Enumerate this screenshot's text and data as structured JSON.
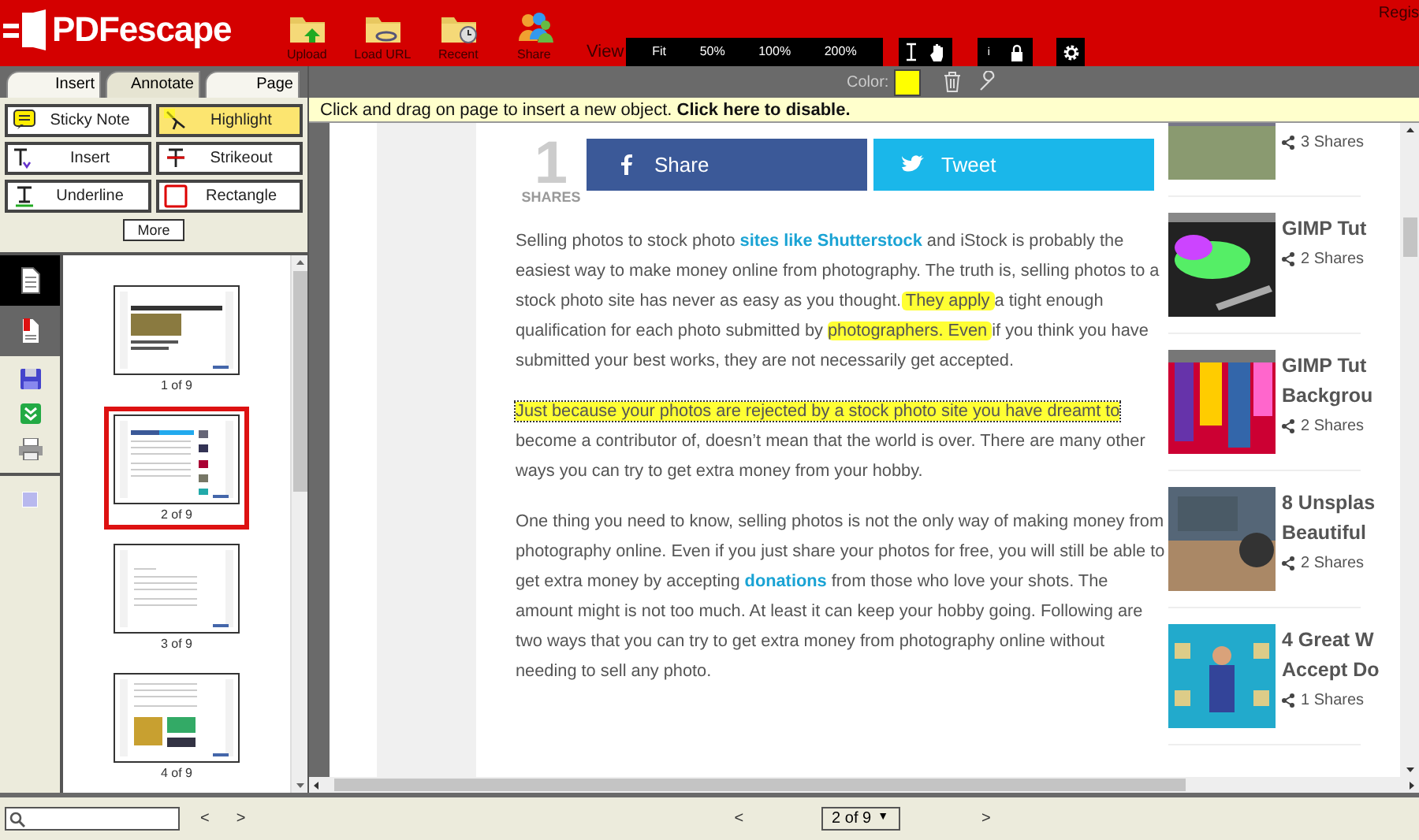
{
  "header": {
    "logo": "PDFescape",
    "register": "Regis",
    "tools": [
      {
        "label": "Upload"
      },
      {
        "label": "Load URL"
      },
      {
        "label": "Recent"
      },
      {
        "label": "Share"
      }
    ],
    "view_label": "View",
    "zoom_options": [
      "Fit",
      "50%",
      "100%",
      "200%"
    ],
    "info_glyph": "i"
  },
  "tabs": [
    {
      "label": "Insert",
      "selected": false
    },
    {
      "label": "Annotate",
      "selected": true
    },
    {
      "label": "Page",
      "selected": false
    }
  ],
  "tools": [
    {
      "label": "Sticky Note",
      "kind": "note",
      "selected": false
    },
    {
      "label": "Highlight",
      "kind": "highlight",
      "selected": true
    },
    {
      "label": "Insert",
      "kind": "insert",
      "selected": false
    },
    {
      "label": "Strikeout",
      "kind": "strike",
      "selected": false
    },
    {
      "label": "Underline",
      "kind": "underline",
      "selected": false
    },
    {
      "label": "Rectangle",
      "kind": "rect",
      "selected": false
    }
  ],
  "more_button": "More",
  "annotation_bar": {
    "color_label": "Color:",
    "color": "#ffff00"
  },
  "hint": "Click and drag on page to insert a new object. **Click here to disable.**",
  "panel_tabs": [
    {
      "selected": true
    },
    {
      "selected": false
    }
  ],
  "thumbnails": [
    {
      "label": "1 of 9",
      "selected": false
    },
    {
      "label": "2 of 9",
      "selected": true
    },
    {
      "label": "3 of 9",
      "selected": false
    },
    {
      "label": "4 of 9",
      "selected": false
    }
  ],
  "document": {
    "share_count": "1",
    "share_caption": "SHARES",
    "share_buttons": [
      {
        "label": "Share",
        "kind": "facebook"
      },
      {
        "label": "Tweet",
        "kind": "twitter"
      }
    ],
    "paragraphs": [
      [
        {
          "text": "Selling photos to stock photo ",
          "kind": "text"
        },
        {
          "text": "sites like Shutterstock",
          "kind": "link"
        },
        {
          "text": " and iStock is probably the easiest way to make money online from photography. The truth is, selling photos to a stock photo site has never as easy as you thought.",
          "kind": "text"
        },
        {
          "text": " They apply ",
          "kind": "highlight",
          "selected": false
        },
        {
          "text": "a tight enough qualification for each photo submitted by ",
          "kind": "text"
        },
        {
          "text": " photographers. Even ",
          "kind": "highlight",
          "selected": false
        },
        {
          "text": "if you think you have submitted your best works, they are not necessarily get accepted.",
          "kind": "text"
        }
      ],
      [
        {
          "text": "Just because your photos are rejected by a stock photo site you have dreamt to",
          "kind": "highlight",
          "selected": true
        },
        {
          "text": " become a contributor of, doesn’t mean that the world is over. There are many other ways you can try to get extra money from your hobby.",
          "kind": "text"
        }
      ],
      [
        {
          "text": "One thing you need to know, selling photos is not the only way of making money from photography online. Even if you just share your photos for free, you will still be able to get extra money by accepting ",
          "kind": "text"
        },
        {
          "text": "donations",
          "kind": "link"
        },
        {
          "text": " from those who love your shots. The amount might is not too much. At least it can keep your hobby going. Following are two ways that you can try to get extra money from photography online without needing to sell any photo.",
          "kind": "text"
        }
      ]
    ],
    "related": [
      {
        "shares": "3 Shares"
      },
      {
        "title_lines": [
          "GIMP Tut"
        ],
        "shares": "2 Shares"
      },
      {
        "title_lines": [
          "GIMP Tut",
          "Backgrou"
        ],
        "shares": "2 Shares"
      },
      {
        "title_lines": [
          "8 Unsplas",
          "Beautiful"
        ],
        "shares": "2 Shares"
      },
      {
        "title_lines": [
          "4 Great W",
          "Accept Do"
        ],
        "shares": "1 Shares"
      }
    ]
  },
  "bottom_bar": {
    "prev": "<",
    "next": ">",
    "page_prev": "<",
    "page_next": ">",
    "page_select": "2 of 9",
    "dropdown_glyph": "▼"
  }
}
